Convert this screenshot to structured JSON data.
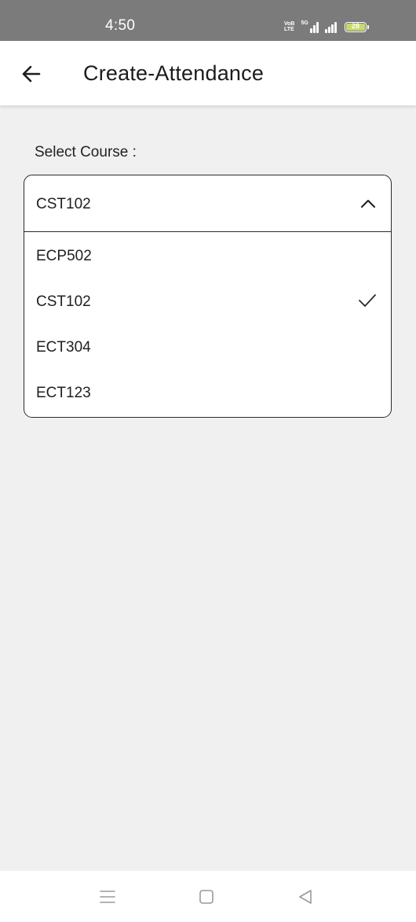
{
  "status_bar": {
    "time": "4:50",
    "volte_top": "VoB",
    "volte_bottom": "LTE",
    "network_tag": "5G",
    "battery": "28"
  },
  "app_bar": {
    "back_icon": "arrow-left-icon",
    "title": "Create-Attendance"
  },
  "form": {
    "label": "Select Course :",
    "selected": "CST102",
    "expanded_icon": "chevron-up-icon",
    "options": [
      {
        "label": "ECP502",
        "checked": false
      },
      {
        "label": "CST102",
        "checked": true
      },
      {
        "label": "ECT304",
        "checked": false
      },
      {
        "label": "ECT123",
        "checked": false
      }
    ],
    "check_icon": "check-icon"
  },
  "nav_bar": {
    "menu_icon": "menu-icon",
    "home_icon": "home-square-icon",
    "back_icon": "back-triangle-icon"
  },
  "colors": {
    "status_bar_bg": "#7b7b7b",
    "page_bg": "#f0f0f0",
    "border": "#2a2a2a"
  }
}
